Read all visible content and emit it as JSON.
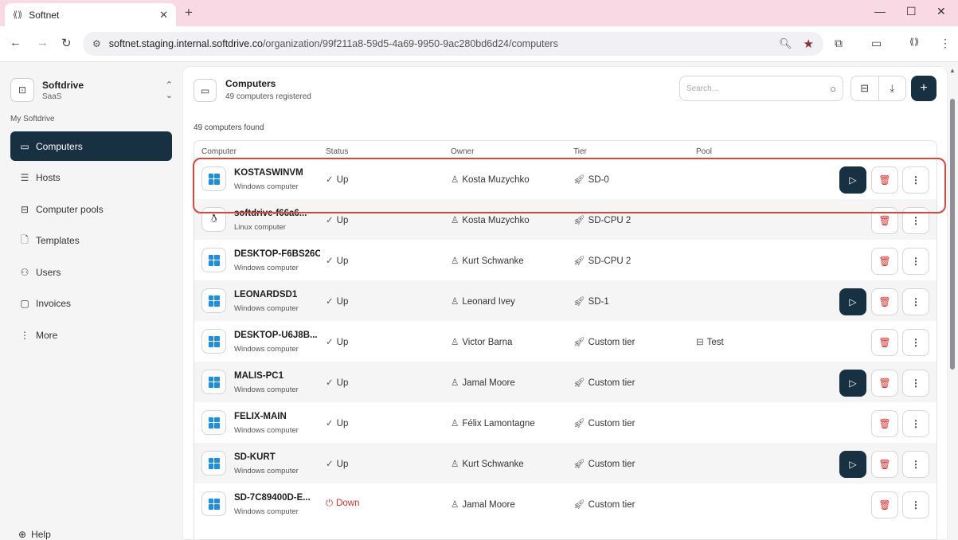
{
  "browser": {
    "tab_title": "Softnet",
    "tab_favicon": "softnet-logo-icon",
    "url_host": "softnet.staging.internal.softdrive.co",
    "url_path": "/organization/99f211a8-59d5-4a69-9950-9ac280bd6d24/computers"
  },
  "sidebar": {
    "org_name": "Softdrive",
    "org_plan": "SaaS",
    "section_label": "My Softdrive",
    "items": [
      {
        "label": "Computers",
        "icon": "monitor-icon"
      },
      {
        "label": "Hosts",
        "icon": "database-icon"
      },
      {
        "label": "Computer pools",
        "icon": "pool-icon"
      },
      {
        "label": "Templates",
        "icon": "file-icon"
      },
      {
        "label": "Users",
        "icon": "users-icon"
      },
      {
        "label": "Invoices",
        "icon": "invoice-icon"
      },
      {
        "label": "More",
        "icon": "more-vertical-icon"
      }
    ],
    "help_label": "Help"
  },
  "header": {
    "title": "Computers",
    "subtitle": "49 computers registered",
    "search_placeholder": "Search..."
  },
  "found_text": "49 computers found",
  "table": {
    "columns": [
      "Computer",
      "Status",
      "Owner",
      "Tier",
      "Pool"
    ],
    "rows": [
      {
        "name": "KOSTASWINVM",
        "kind": "Windows computer",
        "os": "windows",
        "status": "Up",
        "owner": "Kosta Muzychko",
        "tier": "SD-0",
        "pool": "",
        "play": true
      },
      {
        "name": "softdrive-f66a6...",
        "kind": "Linux computer",
        "os": "linux",
        "status": "Up",
        "owner": "Kosta Muzychko",
        "tier": "SD-CPU 2",
        "pool": "",
        "play": false
      },
      {
        "name": "DESKTOP-F6BS26C",
        "kind": "Windows computer",
        "os": "windows",
        "status": "Up",
        "owner": "Kurt Schwanke",
        "tier": "SD-CPU 2",
        "pool": "",
        "play": false
      },
      {
        "name": "LEONARDSD1",
        "kind": "Windows computer",
        "os": "windows",
        "status": "Up",
        "owner": "Leonard Ivey",
        "tier": "SD-1",
        "pool": "",
        "play": true
      },
      {
        "name": "DESKTOP-U6J8B...",
        "kind": "Windows computer",
        "os": "windows",
        "status": "Up",
        "owner": "Victor Barna",
        "tier": "Custom tier",
        "pool": "Test",
        "play": false
      },
      {
        "name": "MALIS-PC1",
        "kind": "Windows computer",
        "os": "windows",
        "status": "Up",
        "owner": "Jamal Moore",
        "tier": "Custom tier",
        "pool": "",
        "play": true
      },
      {
        "name": "FELIX-MAIN",
        "kind": "Windows computer",
        "os": "windows",
        "status": "Up",
        "owner": "Félix Lamontagne",
        "tier": "Custom tier",
        "pool": "",
        "play": false
      },
      {
        "name": "SD-KURT",
        "kind": "Windows computer",
        "os": "windows",
        "status": "Up",
        "owner": "Kurt Schwanke",
        "tier": "Custom tier",
        "pool": "",
        "play": true
      },
      {
        "name": "SD-7C89400D-E...",
        "kind": "Windows computer",
        "os": "windows",
        "status": "Down",
        "owner": "Jamal Moore",
        "tier": "Custom tier",
        "pool": "",
        "play": false
      }
    ]
  },
  "colors": {
    "accent": "#173042",
    "down": "#d92e2e",
    "highlight": "#d24a3a",
    "windows_blue": "#1a8fe3"
  }
}
